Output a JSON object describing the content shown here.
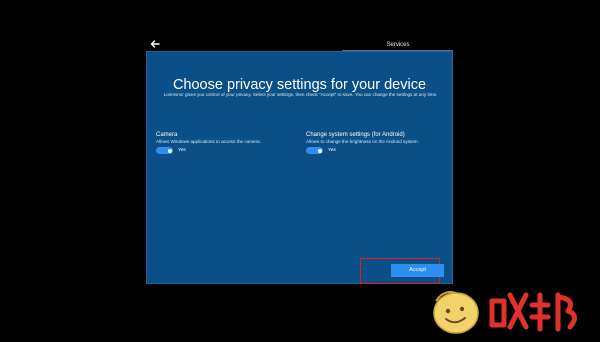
{
  "nav": {
    "back_icon": "arrow-left-icon",
    "tab_label": "Services"
  },
  "page": {
    "title": "Choose privacy settings for your device",
    "description": "LonHonor gives you control of your privacy. Select your settings, then check \"Accept\" to save. You can change the settings at any time."
  },
  "settings": [
    {
      "title": "Camera",
      "description": "Allows Windows applications to access the camera.",
      "state": "Yes",
      "enabled": true
    },
    {
      "title": "Change system settings (for Android)",
      "description": "Allows to change the brightness on the Android system.",
      "state": "Yes",
      "enabled": true
    }
  ],
  "actions": {
    "accept_label": "Accept"
  },
  "colors": {
    "panel": "#0a4f87",
    "accent": "#2f8ff0",
    "highlight": "#e02020"
  }
}
